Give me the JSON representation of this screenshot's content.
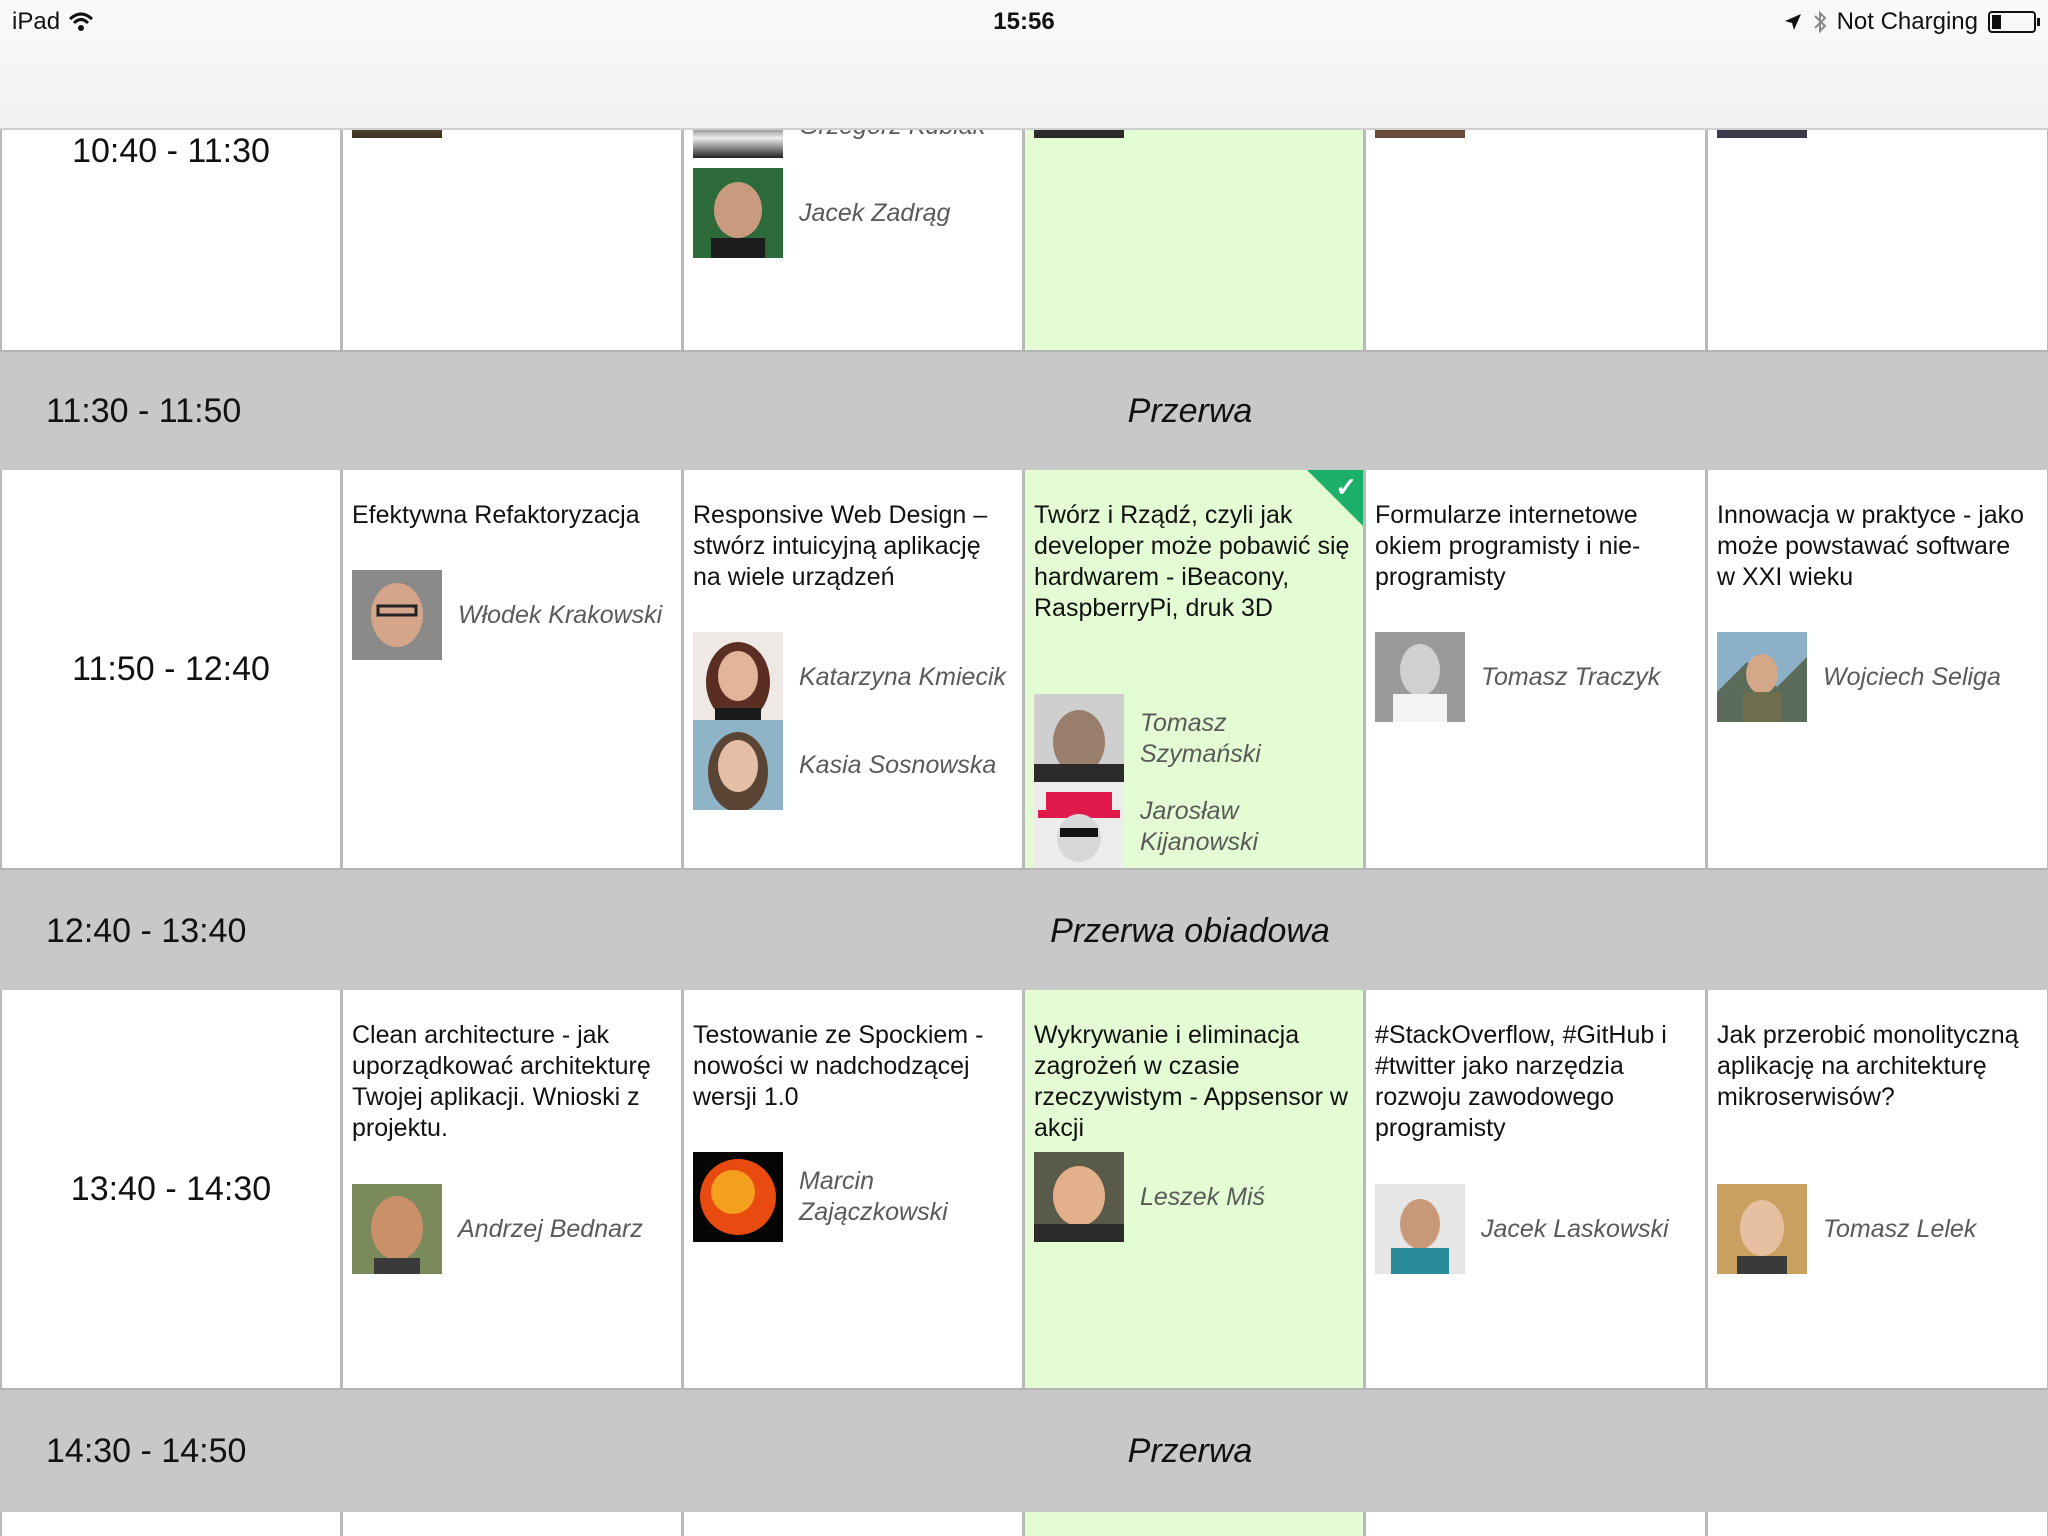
{
  "status": {
    "device": "iPad",
    "time": "15:56",
    "charging": "Not Charging"
  },
  "colors": {
    "highlight": "#e4fcd4",
    "break": "#c8c8c8",
    "check": "#1bb06a"
  },
  "top": {
    "time": "10:40 - 11:30",
    "partial_speaker": "Grzegorz Kubiak",
    "speaker": "Jacek Zadrąg"
  },
  "break1": {
    "time": "11:30 - 11:50",
    "label": "Przerwa"
  },
  "slot2": {
    "time": "11:50 - 12:40",
    "talks": [
      {
        "title": "Efektywna Refaktoryzacja",
        "speakers": [
          "Włodek Krakowski"
        ]
      },
      {
        "title": "Responsive Web Design – stwórz intuicyjną aplikację na wiele urządzeń",
        "speakers": [
          "Katarzyna Kmiecik",
          "Kasia Sosnowska"
        ]
      },
      {
        "title": "Twórz i Rządź, czyli jak developer może pobawić się hardwarem - iBeacony, RaspberryPi, druk 3D",
        "speakers": [
          "Tomasz Szymański",
          "Jarosław Kijanowski"
        ]
      },
      {
        "title": "Formularze internetowe okiem programisty i nie-programisty",
        "speakers": [
          "Tomasz Traczyk"
        ]
      },
      {
        "title": "Innowacja w praktyce - jako może powstawać software w XXI wieku",
        "speakers": [
          "Wojciech Seliga"
        ]
      }
    ]
  },
  "break2": {
    "time": "12:40 - 13:40",
    "label": "Przerwa obiadowa"
  },
  "slot3": {
    "time": "13:40 - 14:30",
    "talks": [
      {
        "title": "Clean architecture - jak uporządkować architekturę Twojej aplikacji. Wnioski z projektu.",
        "speakers": [
          "Andrzej Bednarz"
        ]
      },
      {
        "title": "Testowanie ze Spockiem - nowości w nadchodzącej wersji 1.0",
        "speakers": [
          "Marcin Zajączkowski"
        ]
      },
      {
        "title": "Wykrywanie i eliminacja zagrożeń w czasie rzeczywistym - Appsensor w akcji",
        "speakers": [
          "Leszek Miś"
        ]
      },
      {
        "title": "#StackOverflow, #GitHub i #twitter jako narzędzia rozwoju zawodowego programisty",
        "speakers": [
          "Jacek Laskowski"
        ]
      },
      {
        "title": "Jak przerobić monolityczną aplikację na architekturę mikroserwisów?",
        "speakers": [
          "Tomasz Lelek"
        ]
      }
    ]
  },
  "break3": {
    "time": "14:30 - 14:50",
    "label": "Przerwa"
  }
}
